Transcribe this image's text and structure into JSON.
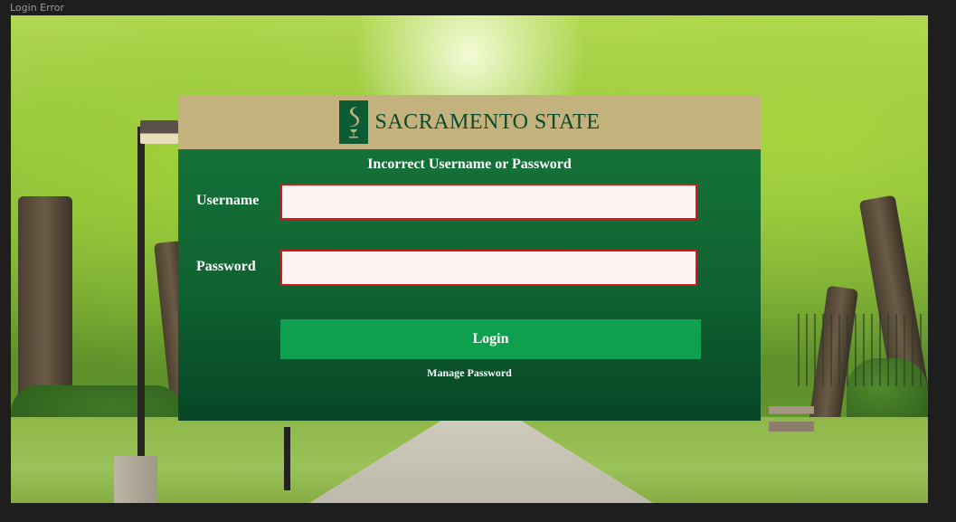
{
  "window": {
    "title": "Login Error"
  },
  "header": {
    "logo_text": "SACRAMENTO STATE"
  },
  "form": {
    "error_message": "Incorrect Username or Password",
    "username_label": "Username",
    "username_value": "",
    "password_label": "Password",
    "password_value": "",
    "login_label": "Login",
    "manage_password_label": "Manage Password"
  },
  "colors": {
    "header_gold": "#c3b27d",
    "brand_green": "#0e5a33",
    "button_green": "#0ea04f",
    "error_border": "#d01b1b",
    "input_bg": "#fff2f3"
  },
  "icons": {
    "logo": "sac-state-hornet-logo-icon"
  }
}
